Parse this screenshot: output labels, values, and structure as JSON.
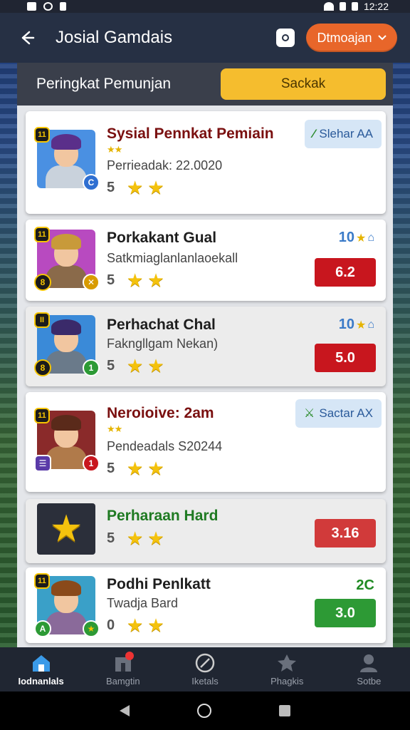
{
  "status_bar": {
    "time": "12:22"
  },
  "app_bar": {
    "title": "Josial Gamdais",
    "dropdown_label": "Dtmoajan",
    "dropdown_icon": "chevron-down-icon"
  },
  "sub_header": {
    "title": "Peringkat Pemunjan",
    "search_label": "Sackak"
  },
  "players": [
    {
      "name": "Sysial Pennkat Pemiain",
      "subline": "Perrieadak: 22.0020",
      "rating": "5",
      "stars": 2,
      "small_stars": "★★",
      "tag_label": "Slehar AA",
      "badge_tl": "11",
      "badge_br": "C",
      "badge_br_color": "#2f6fd1",
      "avatar_bg": "#4a90e2",
      "hair_color": "#5a2f8a",
      "body_color": "#c9d2dc"
    },
    {
      "name": "Porkakant Gual",
      "subline": "Satkmiaglanlanlaoekall",
      "rating": "5",
      "stars": 2,
      "score_top": "10",
      "score": "6.2",
      "badge_tl": "11",
      "badge_bl": "8",
      "badge_br": "✕",
      "badge_br_color": "#d89b00",
      "avatar_bg": "#b84ac0",
      "hair_color": "#c89a3a",
      "body_color": "#8a6a4a"
    },
    {
      "name": "Perhachat Chal",
      "subline": "Fakngllgam Nekan)",
      "rating": "5",
      "stars": 2,
      "score_top": "10",
      "score": "5.0",
      "badge_tl": "II",
      "badge_bl": "8",
      "badge_br": "1",
      "badge_br_color": "#2d9a35",
      "avatar_bg": "#3a8ad8",
      "hair_color": "#3a2a6a",
      "body_color": "#6a7a8a"
    },
    {
      "name": "Neroioive: 2am",
      "subline": "Pendeadals S20244",
      "rating": "5",
      "stars": 2,
      "small_stars": "★★",
      "tag_label": "Sactar AX",
      "badge_tl": "11",
      "badge_bl": "☰",
      "badge_br": "1",
      "badge_br_color": "#c8161e",
      "avatar_bg": "#8a2a2a",
      "hair_color": "#5a2a1a",
      "body_color": "#b07a4a"
    },
    {
      "name": "Perharaan Hard",
      "rating": "5",
      "stars": 2,
      "score": "3.16"
    },
    {
      "name": "Podhi Penlkatt",
      "subline": "Twadja Bard",
      "rating": "0",
      "stars": 2,
      "score_top": "2C",
      "score": "3.0",
      "badge_tl": "11",
      "badge_bl": "A",
      "badge_br": "★",
      "badge_br_color": "#2d9a35",
      "avatar_bg": "#3aa0c8",
      "hair_color": "#8a4a1a",
      "body_color": "#8a6a9a"
    }
  ],
  "bottom_nav": [
    {
      "label": "Iodnanlals",
      "icon": "home-icon",
      "active": true
    },
    {
      "label": "Bamgtin",
      "icon": "store-icon",
      "active": false
    },
    {
      "label": "Iketals",
      "icon": "compass-icon",
      "active": false
    },
    {
      "label": "Phagkis",
      "icon": "badge-icon",
      "active": false
    },
    {
      "label": "Sotbe",
      "icon": "profile-icon",
      "active": false
    }
  ]
}
